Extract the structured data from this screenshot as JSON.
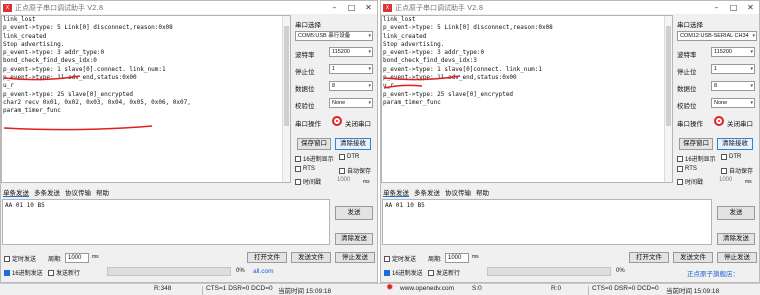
{
  "w1": {
    "title": "正点原子串口调试助手 V2.8",
    "lines": [
      "link_lost",
      "p_event->type: 5 Link[0] disconnect,reason:0x08",
      "link_created",
      "Stop advertising.",
      "p_event->type: 3 addr_type:0",
      "bond_check_find_devs_idx:0",
      "p_event->type: 1 slave[0].connect. link_num:1",
      "p_event->type: 11 adv_end,status:0x00",
      "u_r",
      "p_event->type: 25 slave[0]_encrypted",
      "char2 recv 0x01, 0x02, 0x03, 0x04, 0x05, 0x06, 0x07,",
      "param_timer_func"
    ],
    "port_label": "串口选择",
    "port_value": "COM5:USB 串行设备",
    "baud_label": "波特率",
    "baud_value": "115200",
    "stop_label": "停止位",
    "stop_value": "1",
    "data_label": "数据位",
    "data_value": "8",
    "parity_label": "校验位",
    "parity_value": "None",
    "op_label": "串口操作",
    "close_port": "关闭串口",
    "save_window": "保存窗口",
    "clear_recv": "清除接收",
    "hex_display": "16进制显示",
    "dtr": "DTR",
    "rts": "RTS",
    "auto_save": "自动保存",
    "timestamp": "时间戳",
    "ts_value": "1000",
    "ms_unit": "ms",
    "tabs": [
      "单条发送",
      "多条发送",
      "协议传输",
      "帮助"
    ],
    "send_text": "AA 01 10 B5",
    "send_btn": "发送",
    "clear_send": "清除发送",
    "timed_send": "定时发送",
    "period_label": "周期:",
    "period_value": "1000",
    "hex_send": "16进制发送",
    "send_newline": "发送新行",
    "open_file": "打开文件",
    "send_file": "发送文件",
    "stop_send": "停止发送",
    "percent": "0%",
    "link_text": "all.com",
    "status_r": "R:348",
    "status_lines": "CTS=1 DSR=0 DCD=0",
    "status_time": "当前时间 15:09:18"
  },
  "w2": {
    "title": "正点原子串口调试助手 V2.8",
    "lines": [
      "link_lost",
      "p_event->type: 5 Link[0] disconnect,reason:0x08",
      "link_created",
      "Stop advertising.",
      "p_event->type: 3 addr_type:0",
      "bond_check_find_devs_idx:3",
      "p_event->type: 1 slave[0]connect. link_num:1",
      "p_event->type: 11 adv_end,status:0x00",
      "u_r",
      "p_event->type: 25 slave[0]_encrypted",
      "param_timer_func"
    ],
    "port_label": "串口选择",
    "port_value": "COM12:USB-SERIAL CH34",
    "baud_label": "波特率",
    "baud_value": "115200",
    "stop_label": "停止位",
    "stop_value": "1",
    "data_label": "数据位",
    "data_value": "8",
    "parity_label": "校验位",
    "parity_value": "None",
    "op_label": "串口操作",
    "close_port": "关闭串口",
    "save_window": "保存窗口",
    "clear_recv": "清除接收",
    "hex_display": "16进制显示",
    "dtr": "DTR",
    "rts": "RTS",
    "auto_save": "自动保存",
    "timestamp": "时间戳",
    "ts_value": "1000",
    "ms_unit": "ms",
    "tabs": [
      "单条发送",
      "多条发送",
      "协议传输",
      "帮助"
    ],
    "send_text": "AA 01 10 B5",
    "send_btn": "发送",
    "clear_send": "清除发送",
    "timed_send": "定时发送",
    "period_label": "周期:",
    "period_value": "1000",
    "hex_send": "16进制发送",
    "send_newline": "发送新行",
    "open_file": "打开文件",
    "send_file": "发送文件",
    "stop_send": "停止发送",
    "percent": "0%",
    "link_text": "正点原子旗舰店：",
    "status_web": "www.openedv.com",
    "status_s": "S:0",
    "status_r": "R:0",
    "status_lines": "CTS=0 DSR=0 DCD=0",
    "status_time": "当前时间 15:09:18"
  },
  "colors": {
    "accent": "#1a6fd8",
    "annotation": "#e02020"
  },
  "icons": [
    "app-icon",
    "minimize-icon",
    "maximize-icon",
    "close-icon",
    "record-led-icon",
    "gear-icon"
  ]
}
